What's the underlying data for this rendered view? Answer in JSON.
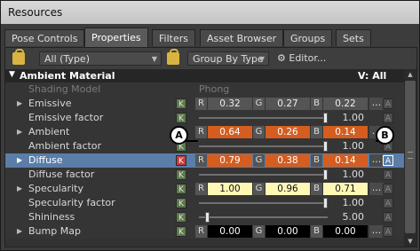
{
  "window": {
    "title": "Resources"
  },
  "tabs": [
    "Pose Controls",
    "Properties",
    "Filters",
    "Asset Browser",
    "Groups",
    "Sets"
  ],
  "toolbar": {
    "type_select": "All (Type)",
    "group_select": "Group By Type",
    "editor_label": "Editor..."
  },
  "section": {
    "title": "Ambient Material",
    "view": "V: All"
  },
  "rows": {
    "shading": {
      "name": "Shading Model",
      "value": "Phong"
    },
    "emissive": {
      "name": "Emissive",
      "k": "K",
      "r": "0.32",
      "g": "0.27",
      "b": "0.22"
    },
    "emissive_factor": {
      "name": "Emissive factor",
      "k": "K",
      "value": "1.00",
      "level": 1.0
    },
    "ambient": {
      "name": "Ambient",
      "k": "K",
      "r": "0.64",
      "g": "0.26",
      "b": "0.14"
    },
    "ambient_factor": {
      "name": "Ambient factor",
      "k": "K",
      "value": "1.00",
      "level": 1.0
    },
    "diffuse": {
      "name": "Diffuse",
      "k": "K",
      "r": "0.79",
      "g": "0.38",
      "b": "0.14"
    },
    "diffuse_factor": {
      "name": "Diffuse factor",
      "k": "K",
      "value": "1.00",
      "level": 1.0
    },
    "specularity": {
      "name": "Specularity",
      "k": "K",
      "r": "1.00",
      "g": "0.96",
      "b": "0.71"
    },
    "specularity_factor": {
      "name": "Specularity factor",
      "k": "K",
      "value": "1.00",
      "level": 1.0
    },
    "shininess": {
      "name": "Shininess",
      "k": "K",
      "value": "5.00",
      "level": 0.05
    },
    "bump_map": {
      "name": "Bump Map",
      "k": "K",
      "r": "0.00",
      "g": "0.00",
      "b": "0.00"
    }
  },
  "labels": {
    "r": "R",
    "g": "G",
    "b": "B",
    "dots": "...",
    "a": "A"
  },
  "callouts": {
    "a": "A",
    "b": "B"
  },
  "colors": {
    "orange": "#d45d1f",
    "yellow": "#fff8b5",
    "key_green": "#5b7a4a",
    "key_red": "#c83a3a",
    "select_blue": "#5a7ea8"
  }
}
